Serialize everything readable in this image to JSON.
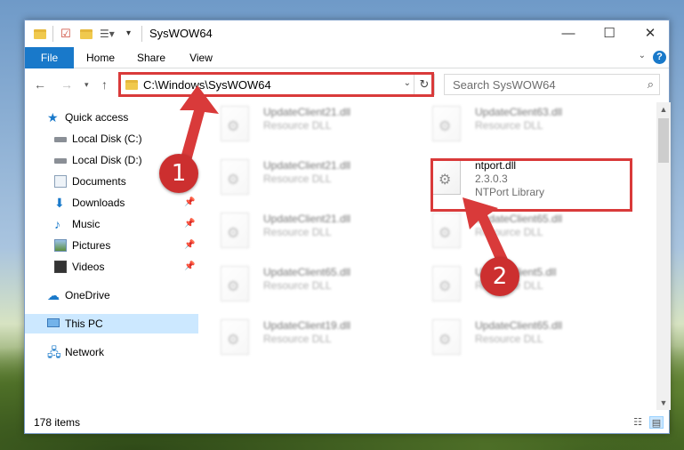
{
  "window": {
    "title": "SysWOW64"
  },
  "window_controls": {
    "minimize": "—",
    "maximize": "☐",
    "close": "✕"
  },
  "ribbon": {
    "tabs": [
      {
        "label": "File"
      },
      {
        "label": "Home"
      },
      {
        "label": "Share"
      },
      {
        "label": "View"
      }
    ],
    "help": "?"
  },
  "address_bar": {
    "path": "C:\\Windows\\SysWOW64"
  },
  "search": {
    "placeholder": "Search SysWOW64"
  },
  "sidebar": {
    "items": [
      {
        "label": "Quick access",
        "icon": "star-icon"
      },
      {
        "label": "Local Disk (C:)",
        "icon": "disk-icon"
      },
      {
        "label": "Local Disk (D:)",
        "icon": "disk-icon"
      },
      {
        "label": "Documents",
        "icon": "documents-icon"
      },
      {
        "label": "Downloads",
        "icon": "download-icon",
        "pinned": true
      },
      {
        "label": "Music",
        "icon": "music-icon",
        "pinned": true
      },
      {
        "label": "Pictures",
        "icon": "pictures-icon",
        "pinned": true
      },
      {
        "label": "Videos",
        "icon": "videos-icon",
        "pinned": true
      },
      {
        "label": "OneDrive",
        "icon": "cloud-icon"
      },
      {
        "label": "This PC",
        "icon": "computer-icon",
        "selected": true
      },
      {
        "label": "Network",
        "icon": "network-icon"
      }
    ]
  },
  "files": {
    "col1": [
      {
        "name": "UpdateClient21.dll",
        "desc": "Resource DLL"
      },
      {
        "name": "UpdateClient21.dll",
        "desc": "Resource DLL"
      },
      {
        "name": "UpdateClient21.dll",
        "desc": "Resource DLL"
      },
      {
        "name": "UpdateClient65.dll",
        "desc": "Resource DLL"
      },
      {
        "name": "UpdateClient19.dll",
        "desc": "Resource DLL"
      }
    ],
    "col2": [
      {
        "name": "UpdateClient63.dll",
        "desc": "Resource DLL"
      },
      {
        "name": "UpdateClient65.dll",
        "desc": "Resource DLL"
      },
      {
        "name": "UpdateClient5.dll",
        "desc": "Resource DLL"
      },
      {
        "name": "UpdateClient65.dll",
        "desc": "Resource DLL"
      }
    ],
    "highlighted": {
      "name": "ntport.dll",
      "version": "2.3.0.3",
      "desc": "NTPort Library"
    }
  },
  "status": {
    "items_count": "178 items"
  },
  "annotations": {
    "step1": "1",
    "step2": "2"
  },
  "colors": {
    "accent": "#1979ca",
    "annotation": "#d93a3a",
    "selected": "#cce8ff"
  }
}
